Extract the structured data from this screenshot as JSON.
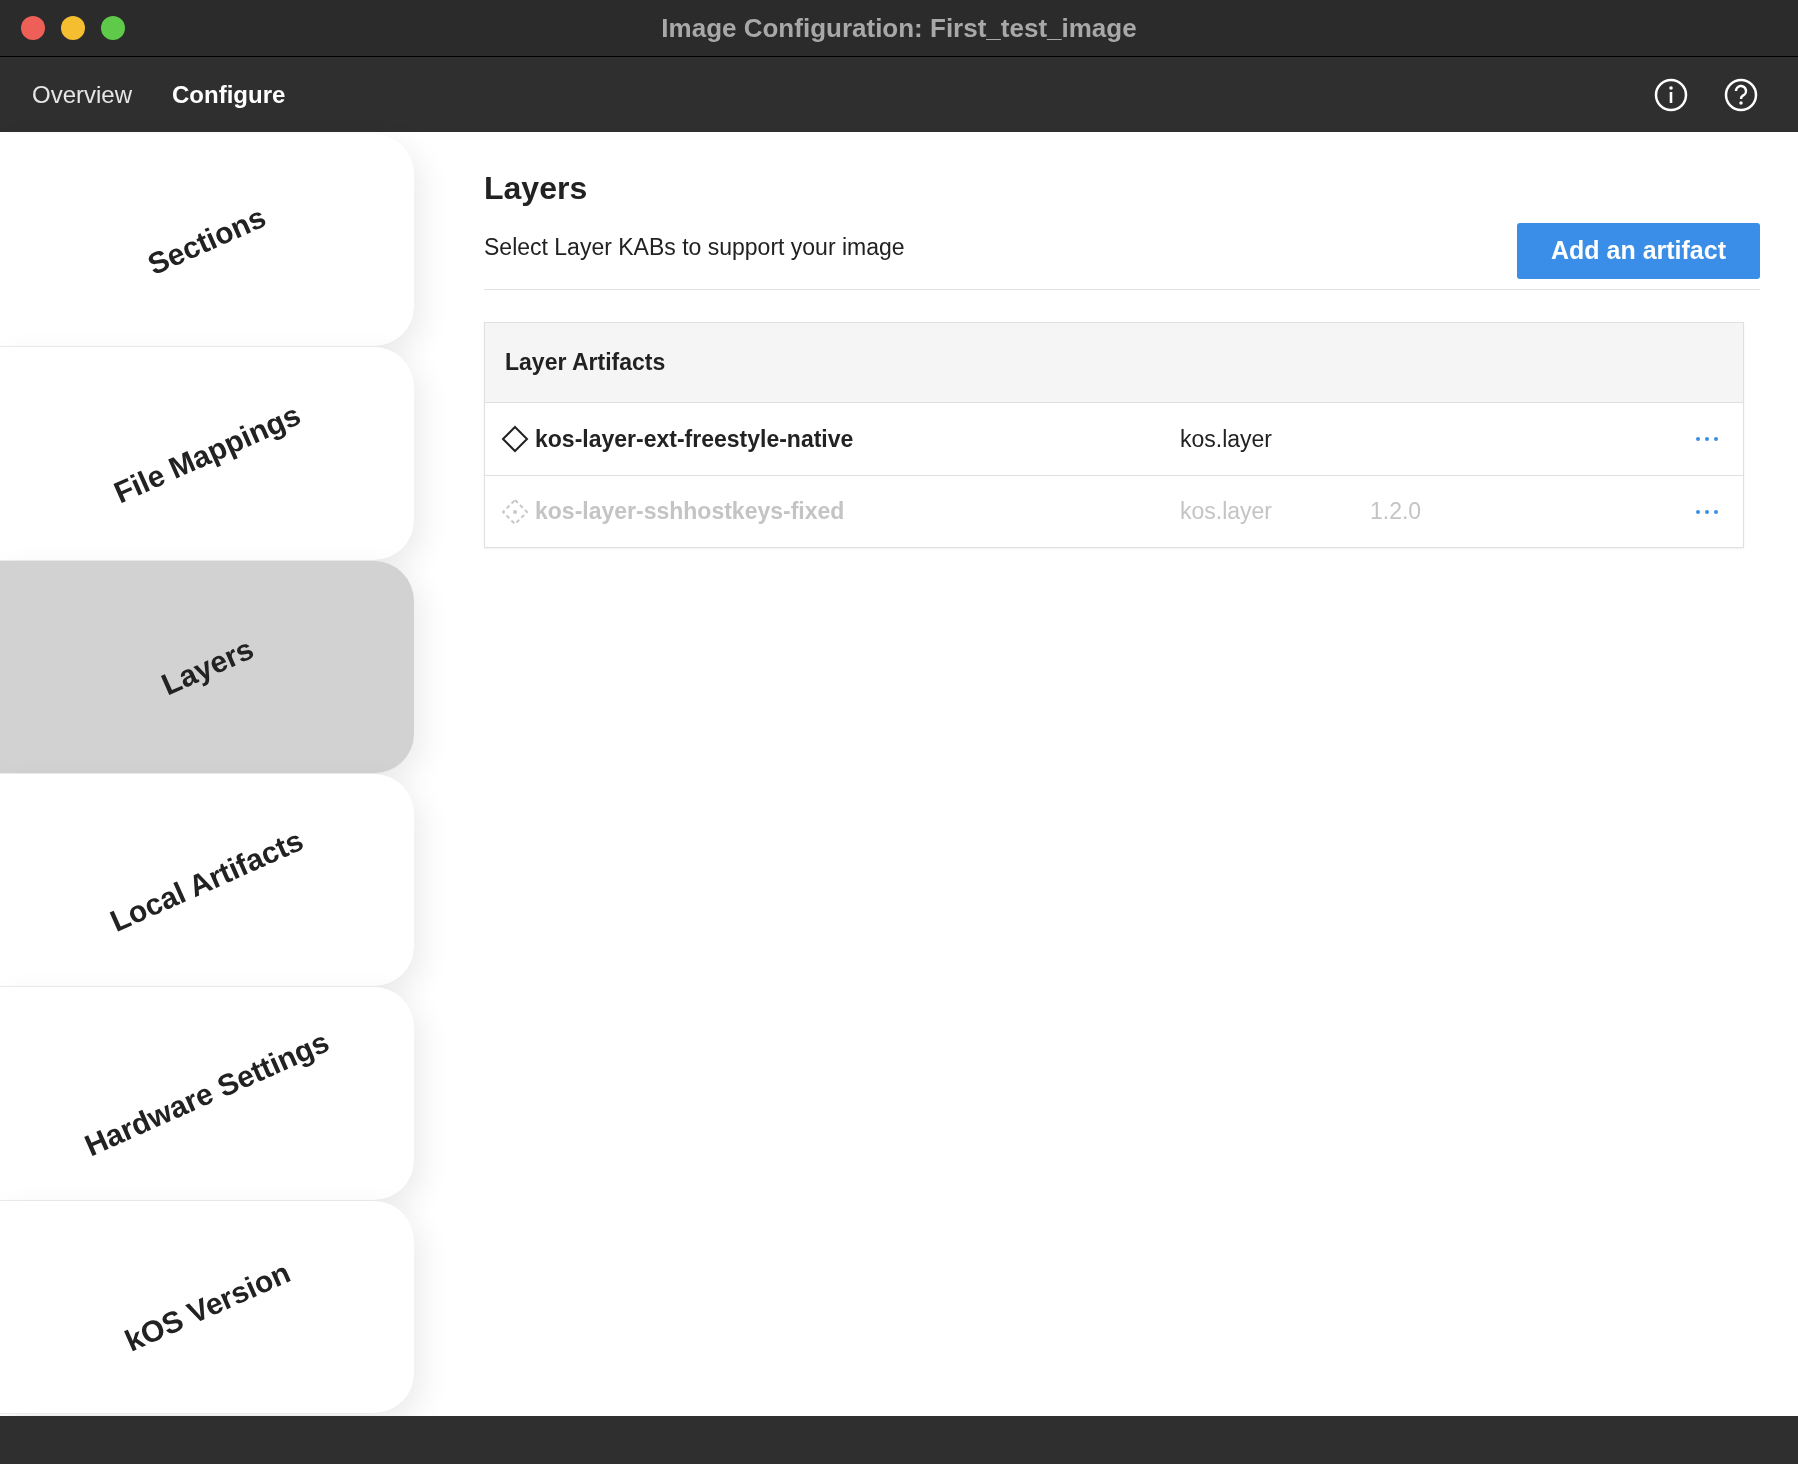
{
  "window": {
    "title": "Image Configuration: First_test_image"
  },
  "tabs": [
    {
      "label": "Overview",
      "selected": false
    },
    {
      "label": "Configure",
      "selected": true
    }
  ],
  "sidebar": {
    "items": [
      {
        "label": "Sections",
        "selected": false
      },
      {
        "label": "File Mappings",
        "selected": false
      },
      {
        "label": "Layers",
        "selected": true
      },
      {
        "label": "Local Artifacts",
        "selected": false
      },
      {
        "label": "Hardware Settings",
        "selected": false
      },
      {
        "label": "kOS Version",
        "selected": false
      }
    ]
  },
  "header": {
    "title": "Layers",
    "subtitle": "Select Layer KABs to support your image",
    "button": "Add an artifact"
  },
  "table": {
    "title": "Layer Artifacts",
    "rows": [
      {
        "name": "kos-layer-ext-freestyle-native",
        "type": "kos.layer",
        "disabled": false
      },
      {
        "name": "kos-layer-sshhostkeys-fixed",
        "type": "kos.layer",
        "version": "1.2.0",
        "disabled": true
      }
    ]
  }
}
